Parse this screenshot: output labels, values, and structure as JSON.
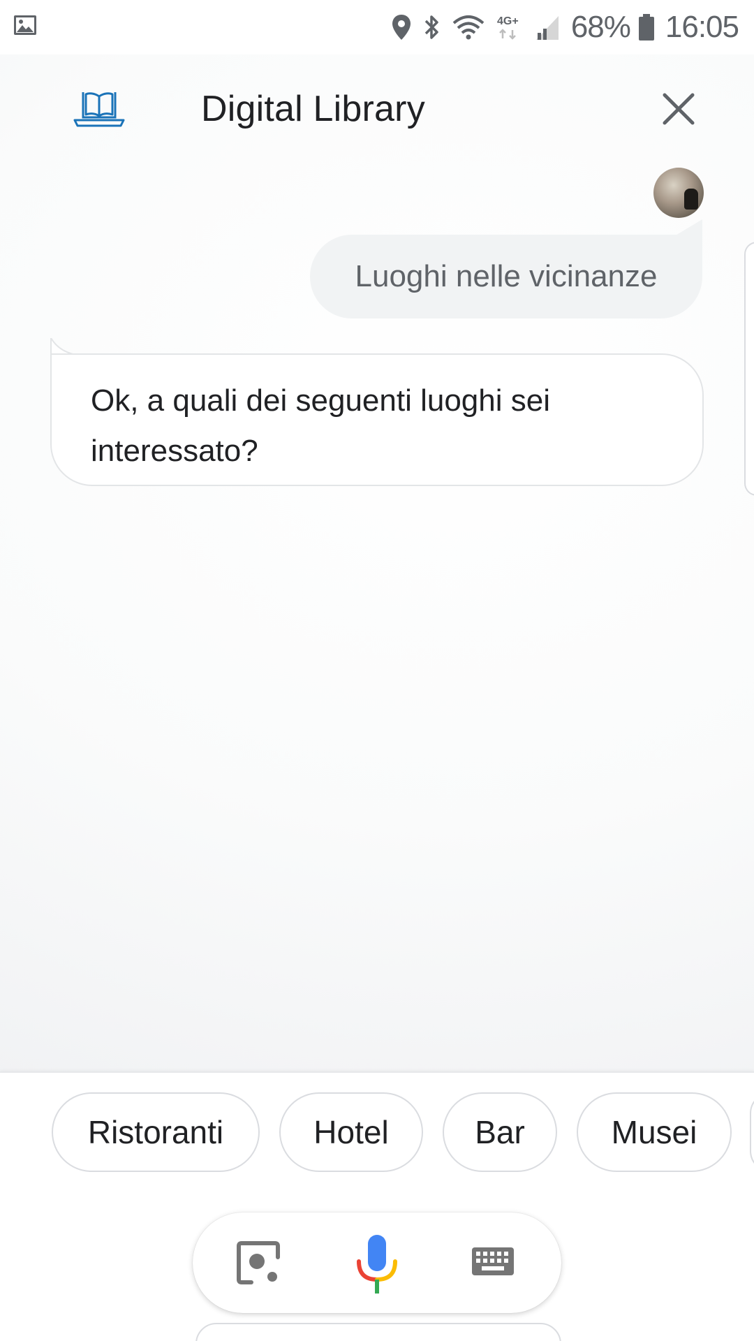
{
  "status_bar": {
    "battery": "68%",
    "time": "16:05",
    "network": "4G+",
    "icons": [
      "gallery-icon",
      "location-icon",
      "bluetooth-icon",
      "wifi-icon",
      "network-4g-icon",
      "signal-icon",
      "battery-icon"
    ]
  },
  "header": {
    "title": "Digital Library",
    "logo_icon": "book-laptop-icon",
    "close_icon": "close-icon"
  },
  "conversation": {
    "user_message": "Luoghi nelle vicinanze",
    "assistant_message": "Ok, a quali dei seguenti luoghi sei interessato?"
  },
  "suggestions": [
    "Ristoranti",
    "Hotel",
    "Bar",
    "Musei"
  ],
  "input_bar": {
    "icons": [
      "lens-icon",
      "microphone-icon",
      "keyboard-icon"
    ]
  },
  "colors": {
    "logo_blue": "#1a73b8",
    "mic_blue": "#4285f4",
    "mic_red": "#ea4335",
    "mic_yellow": "#fbbc05",
    "mic_green": "#34a853",
    "icon_grey": "#757575"
  }
}
